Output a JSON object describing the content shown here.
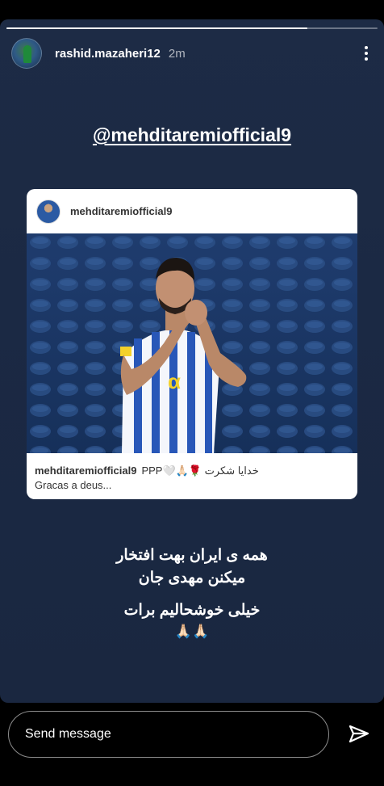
{
  "story": {
    "progress": 0.81,
    "username": "rashid.mazaheri12",
    "time": "2m",
    "mention": "@mehditaremiofficial9"
  },
  "post": {
    "username": "mehditaremiofficial9",
    "caption_user": "mehditaremiofficial9",
    "caption_text": "خدایا شکرت 🌹🙏🏻🤍PPP",
    "caption_line2": "Gracas a deus..."
  },
  "message": {
    "line1": "همه ی ایران بهت افتخار",
    "line2": "میکنن مهدی جان",
    "line3": "خیلی خوشحالیم برات",
    "emoji": "🙏🏻🙏🏻"
  },
  "reply": {
    "placeholder": "Send message"
  },
  "icons": {
    "more": "more-vertical-icon",
    "send": "send-icon"
  }
}
